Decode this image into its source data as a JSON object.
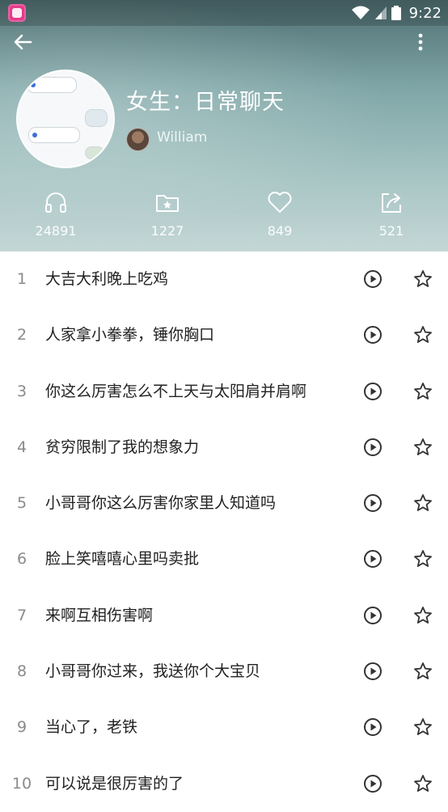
{
  "status_bar": {
    "time": "9:22",
    "icons": [
      "app-icon",
      "wifi-icon",
      "signal-icon",
      "battery-icon"
    ]
  },
  "header": {
    "back_icon": "arrow-left-icon",
    "more_icon": "more-vertical-icon",
    "title": "女生：日常聊天",
    "author": "William"
  },
  "stats": {
    "listens": "24891",
    "collects": "1227",
    "likes": "849",
    "shares": "521"
  },
  "list": [
    {
      "index": "1",
      "text": "大吉大利晚上吃鸡"
    },
    {
      "index": "2",
      "text": "人家拿小拳拳，锤你胸口"
    },
    {
      "index": "3",
      "text": "你这么厉害怎么不上天与太阳肩并肩啊"
    },
    {
      "index": "4",
      "text": "贫穷限制了我的想象力"
    },
    {
      "index": "5",
      "text": "小哥哥你这么厉害你家里人知道吗"
    },
    {
      "index": "6",
      "text": "脸上笑嘻嘻心里吗卖批"
    },
    {
      "index": "7",
      "text": "来啊互相伤害啊"
    },
    {
      "index": "8",
      "text": "小哥哥你过来，我送你个大宝贝"
    },
    {
      "index": "9",
      "text": "当心了，老铁"
    },
    {
      "index": "10",
      "text": "可以说是很厉害的了"
    }
  ],
  "colors": {
    "header_top": "#4f6f72",
    "header_bottom": "#c4d7d6",
    "text_primary": "#222222",
    "text_index": "#8a8a8a"
  }
}
